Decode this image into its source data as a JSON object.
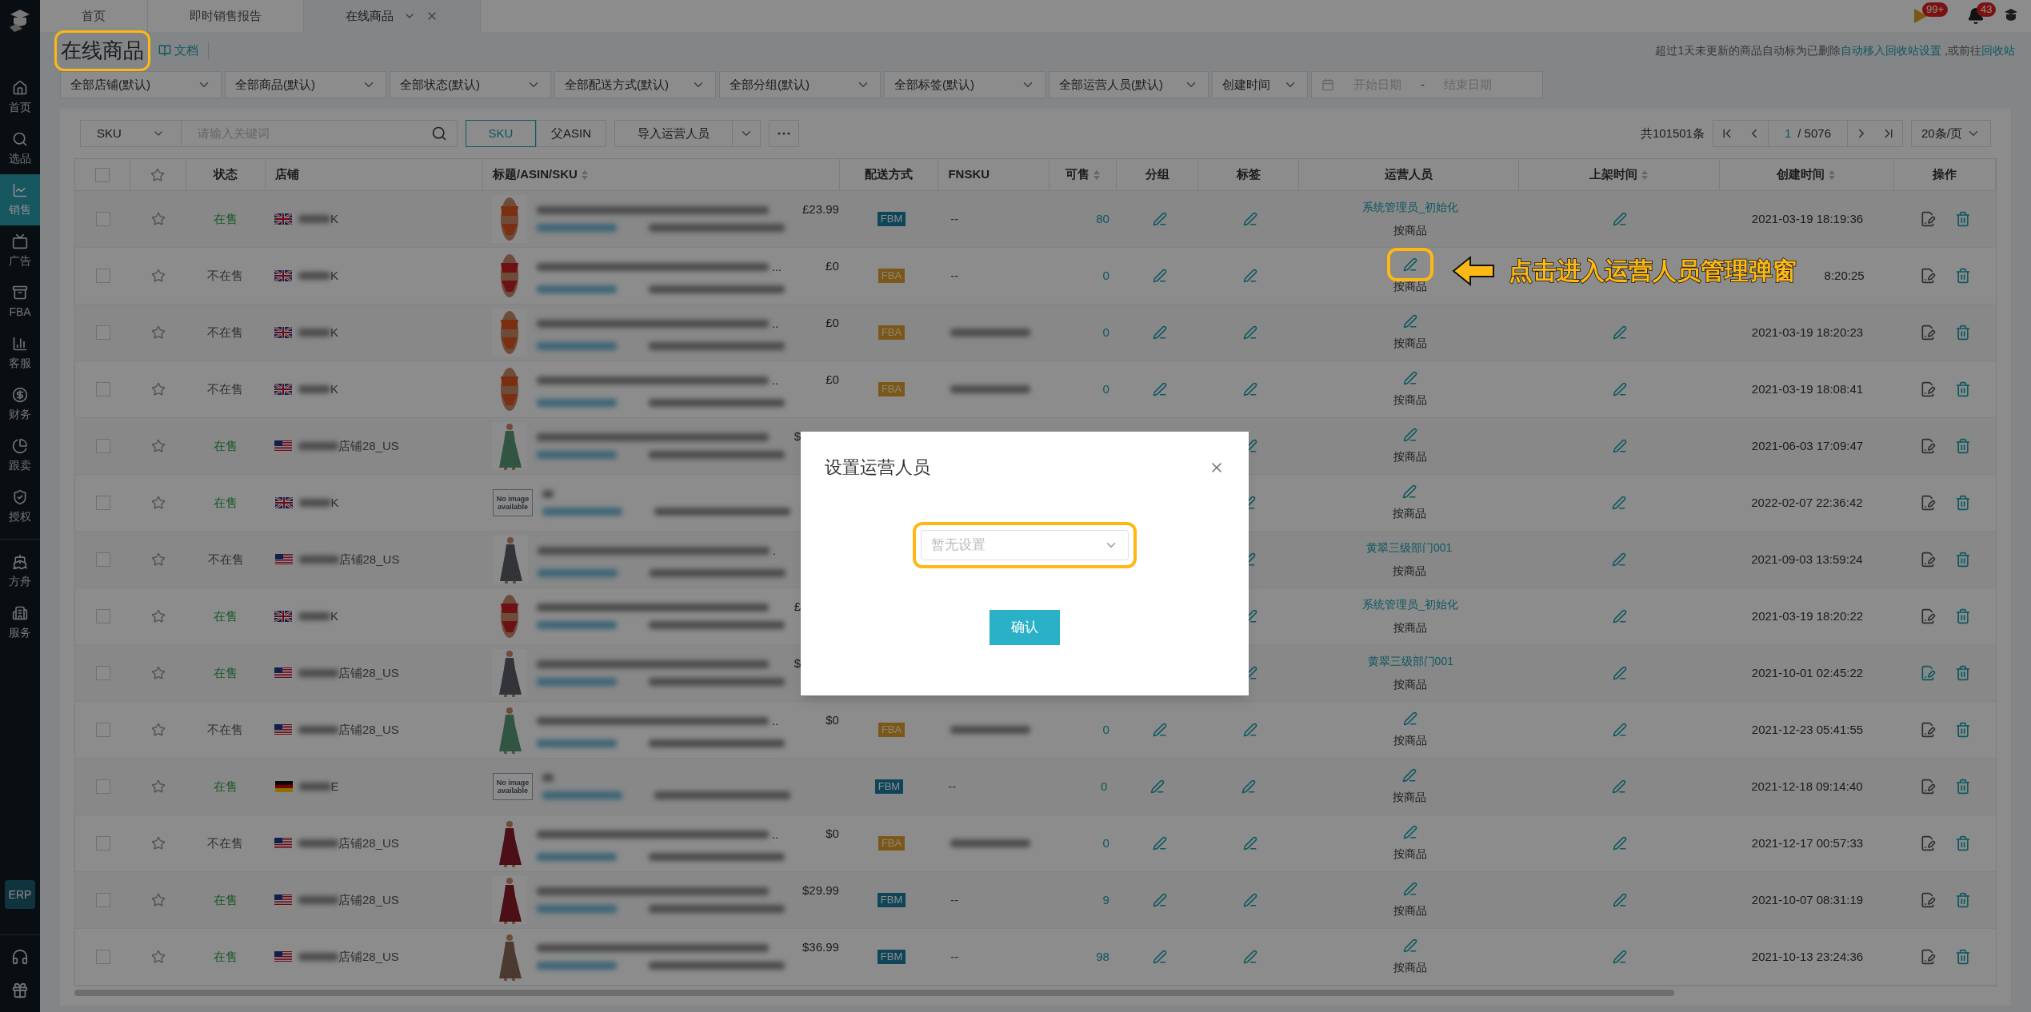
{
  "sidebar": {
    "items": [
      {
        "label": "首页",
        "selected": false
      },
      {
        "label": "选品",
        "selected": false
      },
      {
        "label": "销售",
        "selected": true
      },
      {
        "label": "广告",
        "selected": false
      },
      {
        "label": "FBA",
        "selected": false
      },
      {
        "label": "客服",
        "selected": false
      },
      {
        "label": "财务",
        "selected": false
      },
      {
        "label": "跟卖",
        "selected": false
      },
      {
        "label": "授权",
        "selected": false
      },
      {
        "label": "方舟",
        "selected": false
      },
      {
        "label": "服务",
        "selected": false
      }
    ],
    "badge": "ERP"
  },
  "tabs": [
    {
      "label": "首页",
      "selected": false,
      "closable": false
    },
    {
      "label": "即时销售报告",
      "selected": false,
      "closable": false
    },
    {
      "label": "在线商品",
      "selected": true,
      "closable": true
    }
  ],
  "header": {
    "flag_badge": "99+",
    "bell_badge": "43"
  },
  "page": {
    "title": "在线商品",
    "highlighted": true,
    "doc_link": "文档",
    "notice": "超过1天未更新的商品自动标为已删除",
    "notice_link": "自动移入回收站设置",
    "notice_tail": " ,或前往",
    "notice_link2": "回收站"
  },
  "filters": [
    {
      "label": "全部店铺(默认)"
    },
    {
      "label": "全部商品(默认)"
    },
    {
      "label": "全部状态(默认)"
    },
    {
      "label": "全部配送方式(默认)"
    },
    {
      "label": "全部分组(默认)"
    },
    {
      "label": "全部标签(默认)"
    },
    {
      "label": "全部运营人员(默认)"
    },
    {
      "label": "创建时间"
    }
  ],
  "date_range": {
    "start_placeholder": "开始日期",
    "separator": "-",
    "end_placeholder": "结束日期"
  },
  "toolbar": {
    "search_type": "SKU",
    "search_placeholder": "请输入关键词",
    "view_toggle": [
      {
        "label": "SKU",
        "selected": true
      },
      {
        "label": "父ASIN",
        "selected": false
      }
    ],
    "import_button": "导入运营人员"
  },
  "pagination": {
    "total": "共101501条",
    "page": "1",
    "pages": "/ 5076",
    "page_size": "20条/页"
  },
  "table": {
    "columns": [
      {
        "kind": "checkbox",
        "checked": false
      },
      {
        "kind": "star"
      },
      {
        "kind": "text",
        "label": "状态",
        "sortable": false
      },
      {
        "kind": "text",
        "label": "店铺",
        "sortable": false
      },
      {
        "kind": "text",
        "label": "标题/ASIN/SKU",
        "sortable": true
      },
      {
        "kind": "text",
        "label": "配送方式",
        "sortable": false
      },
      {
        "kind": "text",
        "label": "FNSKU",
        "sortable": false
      },
      {
        "kind": "text",
        "label": "可售",
        "sortable": true
      },
      {
        "kind": "text",
        "label": "分组",
        "sortable": false
      },
      {
        "kind": "text",
        "label": "标签",
        "sortable": false
      },
      {
        "kind": "text",
        "label": "运营人员",
        "sortable": false
      },
      {
        "kind": "text",
        "label": "上架时间",
        "sortable": true
      },
      {
        "kind": "text",
        "label": "创建时间",
        "sortable": true
      },
      {
        "kind": "text",
        "label": "操作",
        "sortable": false
      }
    ],
    "rows": [
      {
        "checked": false,
        "status": "在售",
        "on_sale": true,
        "store": {
          "kind": "uk",
          "name": "K"
        },
        "price": "£23.99",
        "delivery": {
          "kind": "fbm",
          "label": "FBM"
        },
        "fnsku": "--",
        "available": "80",
        "operator": "系统管理员_初始化",
        "mode": "按商品",
        "highlighted": false,
        "created": "2021-03-19 18:19:36",
        "note_active": false
      },
      {
        "checked": false,
        "status": "不在售",
        "on_sale": false,
        "store": {
          "kind": "uk",
          "name": "K"
        },
        "title_tail": "...",
        "price": "£0",
        "delivery": {
          "kind": "fba",
          "label": "FBA"
        },
        "fnsku": "--",
        "available": "0",
        "mode": "按商品",
        "highlighted": true,
        "created": "8:20:25",
        "note_active": false
      },
      {
        "checked": false,
        "status": "不在售",
        "on_sale": false,
        "store": {
          "kind": "uk",
          "name": "K"
        },
        "title_tail": "..",
        "price": "£0",
        "delivery": {
          "kind": "fba",
          "label": "FBA"
        },
        "fnsku_blurred": true,
        "available": "0",
        "mode": "按商品",
        "highlighted": false,
        "created": "2021-03-19 18:20:23",
        "note_active": false
      },
      {
        "checked": false,
        "status": "不在售",
        "on_sale": false,
        "store": {
          "kind": "uk",
          "name": "K"
        },
        "title_tail": "..",
        "price": "£0",
        "delivery": {
          "kind": "fba",
          "label": "FBA"
        },
        "fnsku_blurred": true,
        "available": "0",
        "mode": "按商品",
        "highlighted": false,
        "created": "2021-03-19 18:08:41",
        "note_active": false
      },
      {
        "checked": false,
        "status": "在售",
        "on_sale": true,
        "store": {
          "kind": "us",
          "name": "店铺28_US"
        },
        "price": "$",
        "price_clipped": true,
        "mode": "按商品",
        "highlighted": false,
        "created": "2021-06-03 17:09:47",
        "note_active": false
      },
      {
        "checked": false,
        "status": "在售",
        "on_sale": true,
        "store": {
          "kind": "uk",
          "name": "K"
        },
        "image": {
          "kind": "placeholder",
          "text": "No image available"
        },
        "mode": "按商品",
        "highlighted": false,
        "created": "2022-02-07 22:36:42",
        "note_active": false
      },
      {
        "checked": false,
        "status": "不在售",
        "on_sale": false,
        "store": {
          "kind": "us",
          "name": "店铺28_US"
        },
        "title_tail": ".",
        "operator": "黄翠三级部门001",
        "mode": "按商品",
        "highlighted": false,
        "created": "2021-09-03 13:59:24",
        "note_active": false
      },
      {
        "checked": false,
        "status": "在售",
        "on_sale": true,
        "store": {
          "kind": "uk",
          "name": "K"
        },
        "price": "£",
        "price_clipped": true,
        "operator": "系统管理员_初始化",
        "mode": "按商品",
        "highlighted": false,
        "created": "2021-03-19 18:20:22",
        "note_active": false
      },
      {
        "checked": false,
        "status": "在售",
        "on_sale": true,
        "store": {
          "kind": "us",
          "name": "店铺28_US"
        },
        "price": "$",
        "price_clipped": true,
        "operator": "黄翠三级部门001",
        "mode": "按商品",
        "highlighted": false,
        "created": "2021-10-01 02:45:22",
        "note_active": true
      },
      {
        "checked": false,
        "status": "不在售",
        "on_sale": false,
        "store": {
          "kind": "us",
          "name": "店铺28_US"
        },
        "title_tail": "..",
        "price": "$0",
        "delivery": {
          "kind": "fba",
          "label": "FBA"
        },
        "fnsku_blurred": true,
        "available": "0",
        "mode": "按商品",
        "highlighted": false,
        "created": "2021-12-23 05:41:55",
        "note_active": false
      },
      {
        "checked": false,
        "status": "在售",
        "on_sale": true,
        "store": {
          "kind": "de",
          "name": "E"
        },
        "image": {
          "kind": "placeholder",
          "text": "No image available"
        },
        "delivery": {
          "kind": "fbm",
          "label": "FBM"
        },
        "fnsku": "--",
        "available": "0",
        "mode": "按商品",
        "highlighted": false,
        "created": "2021-12-18 09:14:40",
        "note_active": false
      },
      {
        "checked": false,
        "status": "不在售",
        "on_sale": false,
        "store": {
          "kind": "us",
          "name": "店铺28_US"
        },
        "title_tail": "..",
        "price": "$0",
        "delivery": {
          "kind": "fba",
          "label": "FBA"
        },
        "fnsku_blurred": true,
        "available": "0",
        "mode": "按商品",
        "highlighted": false,
        "created": "2021-12-17 00:57:33",
        "note_active": false
      },
      {
        "checked": false,
        "status": "在售",
        "on_sale": true,
        "store": {
          "kind": "us",
          "name": "店铺28_US"
        },
        "price": "$29.99",
        "delivery": {
          "kind": "fbm",
          "label": "FBM"
        },
        "fnsku": "--",
        "available": "9",
        "mode": "按商品",
        "highlighted": false,
        "created": "2021-10-07 08:31:19",
        "note_active": false
      },
      {
        "checked": false,
        "status": "在售",
        "on_sale": true,
        "store": {
          "kind": "us",
          "name": "店铺28_US"
        },
        "price": "$36.99",
        "delivery": {
          "kind": "fbm",
          "label": "FBM"
        },
        "fnsku": "--",
        "available": "98",
        "mode": "按商品",
        "highlighted": false,
        "created": "2021-10-13 23:24:36",
        "note_active": false
      }
    ]
  },
  "dialog": {
    "title": "设置运营人员",
    "select_placeholder": "暂无设置",
    "highlighted": true,
    "confirm": "确认"
  },
  "annotation": {
    "text": "点击进入运营人员管理弹窗"
  }
}
